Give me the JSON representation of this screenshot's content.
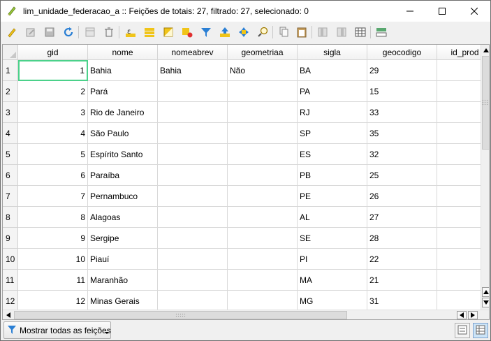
{
  "window": {
    "title": "lim_unidade_federacao_a :: Feições de totais: 27, filtrado: 27, selecionado: 0"
  },
  "toolbar": {
    "buttons": [
      "pencil-edit-icon",
      "multi-edit-icon",
      "save-edits-icon",
      "reload-icon",
      "add-feature-icon",
      "delete-feature-icon",
      "expression-select-icon",
      "select-all-icon",
      "invert-selection-icon",
      "deselect-all-icon",
      "filter-icon",
      "move-selection-top-icon",
      "pan-to-selection-icon",
      "zoom-to-selection-icon",
      "copy-icon",
      "paste-icon",
      "new-field-icon",
      "delete-field-icon",
      "field-calculator-icon",
      "conditional-format-icon"
    ]
  },
  "table": {
    "columns": [
      "gid",
      "nome",
      "nomeabrev",
      "geometriaa",
      "sigla",
      "geocodigo",
      "id_prod"
    ],
    "rows": [
      {
        "row": "1",
        "gid": "1",
        "nome": "Bahia",
        "nomeabrev": "Bahia",
        "geometriaa": "Não",
        "sigla": "BA",
        "geocodigo": "29",
        "id_prod": ""
      },
      {
        "row": "2",
        "gid": "2",
        "nome": "Pará",
        "nomeabrev": "",
        "geometriaa": "",
        "sigla": "PA",
        "geocodigo": "15",
        "id_prod": ""
      },
      {
        "row": "3",
        "gid": "3",
        "nome": "Rio de Janeiro",
        "nomeabrev": "",
        "geometriaa": "",
        "sigla": "RJ",
        "geocodigo": "33",
        "id_prod": ""
      },
      {
        "row": "4",
        "gid": "4",
        "nome": "São Paulo",
        "nomeabrev": "",
        "geometriaa": "",
        "sigla": "SP",
        "geocodigo": "35",
        "id_prod": ""
      },
      {
        "row": "5",
        "gid": "5",
        "nome": "Espírito Santo",
        "nomeabrev": "",
        "geometriaa": "",
        "sigla": "ES",
        "geocodigo": "32",
        "id_prod": ""
      },
      {
        "row": "6",
        "gid": "6",
        "nome": "Paraíba",
        "nomeabrev": "",
        "geometriaa": "",
        "sigla": "PB",
        "geocodigo": "25",
        "id_prod": ""
      },
      {
        "row": "7",
        "gid": "7",
        "nome": "Pernambuco",
        "nomeabrev": "",
        "geometriaa": "",
        "sigla": "PE",
        "geocodigo": "26",
        "id_prod": ""
      },
      {
        "row": "8",
        "gid": "8",
        "nome": "Alagoas",
        "nomeabrev": "",
        "geometriaa": "",
        "sigla": "AL",
        "geocodigo": "27",
        "id_prod": ""
      },
      {
        "row": "9",
        "gid": "9",
        "nome": "Sergipe",
        "nomeabrev": "",
        "geometriaa": "",
        "sigla": "SE",
        "geocodigo": "28",
        "id_prod": ""
      },
      {
        "row": "10",
        "gid": "10",
        "nome": "Piauí",
        "nomeabrev": "",
        "geometriaa": "",
        "sigla": "PI",
        "geocodigo": "22",
        "id_prod": ""
      },
      {
        "row": "11",
        "gid": "11",
        "nome": "Maranhão",
        "nomeabrev": "",
        "geometriaa": "",
        "sigla": "MA",
        "geocodigo": "21",
        "id_prod": ""
      },
      {
        "row": "12",
        "gid": "12",
        "nome": "Minas Gerais",
        "nomeabrev": "",
        "geometriaa": "",
        "sigla": "MG",
        "geocodigo": "31",
        "id_prod": ""
      }
    ]
  },
  "footer": {
    "filter_label": "Mostrar todas as feições",
    "view_buttons": [
      "form-view-icon",
      "table-view-icon"
    ]
  },
  "colors": {
    "selection_border": "#4bd18a",
    "filter_icon": "#2a7fd4"
  }
}
